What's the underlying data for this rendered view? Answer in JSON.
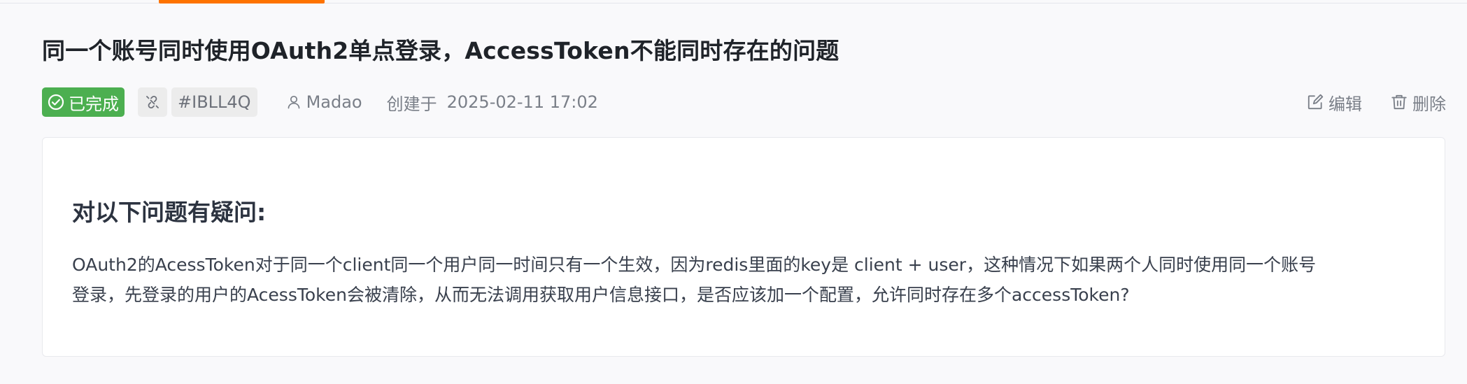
{
  "issue": {
    "title": "同一个账号同时使用OAuth2单点登录，AccessToken不能同时存在的问题",
    "status_label": "已完成",
    "id": "#IBLL4Q",
    "author": "Madao",
    "created_label": "创建于",
    "created_time": "2025-02-11 17:02"
  },
  "actions": {
    "edit_label": "编辑",
    "delete_label": "删除"
  },
  "content": {
    "heading": "对以下问题有疑问:",
    "body_line1": "OAuth2的AcessToken对于同一个client同一个用户同一时间只有一个生效，因为redis里面的key是 client + user，这种情况下如果两个人同时使用同一个账号",
    "body_line2": "登录，先登录的用户的AcessToken会被清除，从而无法调用获取用户信息接口，是否应该加一个配置，允许同时存在多个accessToken?"
  },
  "colors": {
    "accent": "#fe7300",
    "status_done": "#4caf50"
  },
  "icons": [
    "check-circle-icon",
    "link-icon",
    "user-icon",
    "edit-icon",
    "trash-icon"
  ]
}
